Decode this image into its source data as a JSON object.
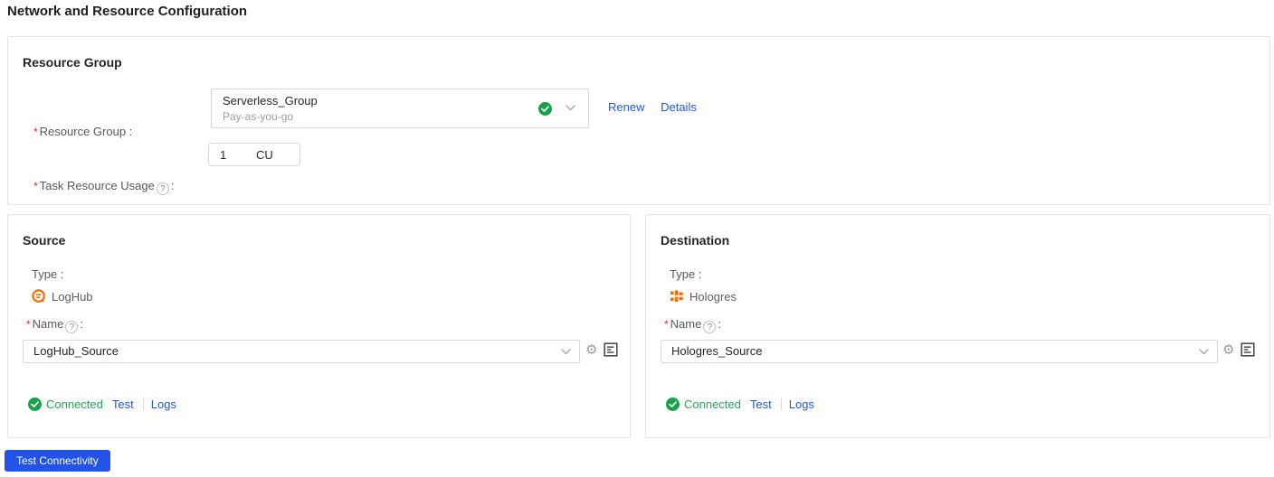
{
  "page": {
    "title": "Network and Resource Configuration"
  },
  "resource_group_panel": {
    "heading": "Resource Group",
    "required_marker": "*",
    "resource_group_label": "Resource Group :",
    "select": {
      "value": "Serverless_Group",
      "subtitle": "Pay-as-you-go"
    },
    "renew_link": "Renew",
    "details_link": "Details",
    "task_usage_label": "Task Resource Usage",
    "task_usage_colon": ":",
    "task_usage_value": "1",
    "task_usage_unit": "CU"
  },
  "source_panel": {
    "heading": "Source",
    "required_marker": "*",
    "type_label": "Type :",
    "type_value": "LogHub",
    "name_label": "Name",
    "name_colon": ":",
    "select_value": "LogHub_Source",
    "status": "Connected",
    "test_link": "Test",
    "logs_link": "Logs"
  },
  "destination_panel": {
    "heading": "Destination",
    "required_marker": "*",
    "type_label": "Type :",
    "type_value": "Hologres",
    "name_label": "Name",
    "name_colon": ":",
    "select_value": "Hologres_Source",
    "status": "Connected",
    "test_link": "Test",
    "logs_link": "Logs"
  },
  "footer": {
    "test_connectivity_label": "Test Connectivity"
  },
  "icons": {
    "help_glyph": "?",
    "gear_glyph": "⚙"
  },
  "colors": {
    "link_blue": "#2158e8",
    "button_blue": "#2253e6",
    "status_green": "#2aa45c",
    "brand_orange": "#ff6a00",
    "required_red": "#f5222d"
  }
}
